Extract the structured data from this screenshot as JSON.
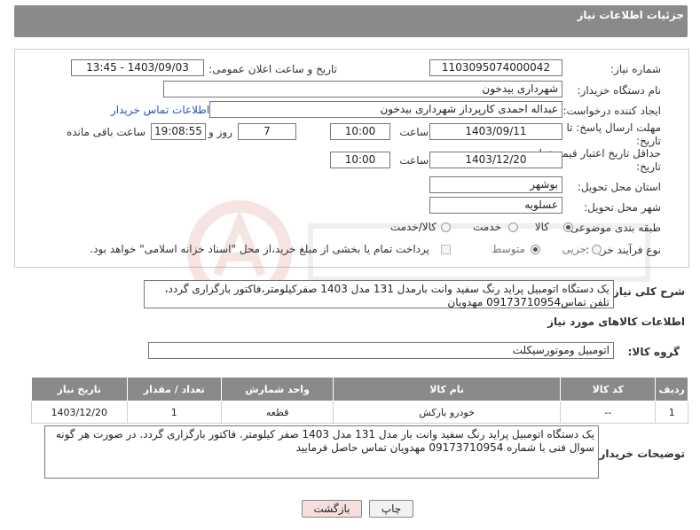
{
  "header": {
    "title": "جزئیات اطلاعات نیاز"
  },
  "fields": {
    "need_number_label": "شماره نیاز:",
    "need_number": "1103095074000042",
    "announce_label": "تاریخ و ساعت اعلان عمومی:",
    "announce_value": "1403/09/03 - 13:45",
    "buyer_label": "نام دستگاه خریدار:",
    "buyer_value": "شهرداری بیدخون",
    "creator_label": "ایجاد کننده درخواست:",
    "creator_value": "عبداله احمدی کارپرداز شهرداری بیدخون",
    "contact_link": "اطلاعات تماس خریدار",
    "deadline_label_1": "مهلت ارسال پاسخ: تا",
    "deadline_label_2": "تاریخ:",
    "deadline_date": "1403/09/11",
    "time_label": "ساعت",
    "deadline_time": "10:00",
    "days_value": "7",
    "days_label": "روز و",
    "remaining_time": "19:08:55",
    "remaining_label": "ساعت باقی مانده",
    "validity_label_1": "حداقل تاریخ اعتبار قیمت: تا",
    "validity_label_2": "تاریخ:",
    "validity_date": "1403/12/20",
    "validity_time": "10:00",
    "province_label": "استان محل تحویل:",
    "province_value": "بوشهر",
    "city_label": "شهر محل تحویل:",
    "city_value": "عسلویه",
    "category_label": "طبقه بندی موضوعی:",
    "category_options": [
      "کالا",
      "خدمت",
      "کالا/خدمت"
    ],
    "category_selected": "کالا",
    "process_label": "نوع فرآیند خرید :",
    "process_options": [
      "جزیی",
      "متوسط"
    ],
    "process_selected": "متوسط",
    "payment_text": "پرداخت تمام یا بخشی از مبلغ خرید،از محل \"اسناد خزانه اسلامی\" خواهد بود."
  },
  "summary": {
    "label": "شرح کلی نیاز:",
    "text": "یک دستگاه اتومبیل پراید رنگ سفید وانت بارمدل 131 مدل 1403 صفرکیلومتر،فاکتور بارگزاری گردد، تلفن تماس09173710954 مهدویان"
  },
  "goods": {
    "section_title": "اطلاعات کالاهای مورد نیاز",
    "group_label": "گروه کالا:",
    "group_value": "اتومبیل وموتورسیکلت"
  },
  "table": {
    "headers": [
      "ردیف",
      "کد کالا",
      "نام کالا",
      "واحد شمارش",
      "تعداد / مقدار",
      "تاریخ نیاز"
    ],
    "rows": [
      [
        "1",
        "--",
        "خودرو بارکش",
        "قطعه",
        "1",
        "1403/12/20"
      ]
    ]
  },
  "buyer_notes": {
    "label": "توضیحات خریدار:",
    "text": "یک دستگاه اتومبیل پراید رنگ سفید وانت بار مدل 131 مدل 1403 صفر کیلومتر. فاکتور بارگزاری گردد. در صورت هر گونه سوال فنی با شماره 09173710954 مهدویان تماس حاصل فرمایید"
  },
  "buttons": {
    "print": "چاپ",
    "back": "بازگشت"
  },
  "colors": {
    "header_bg": "#8a8a8a",
    "link": "#2a52be",
    "back_button_bg": "#f6dede",
    "watermark": "#c0392b"
  }
}
